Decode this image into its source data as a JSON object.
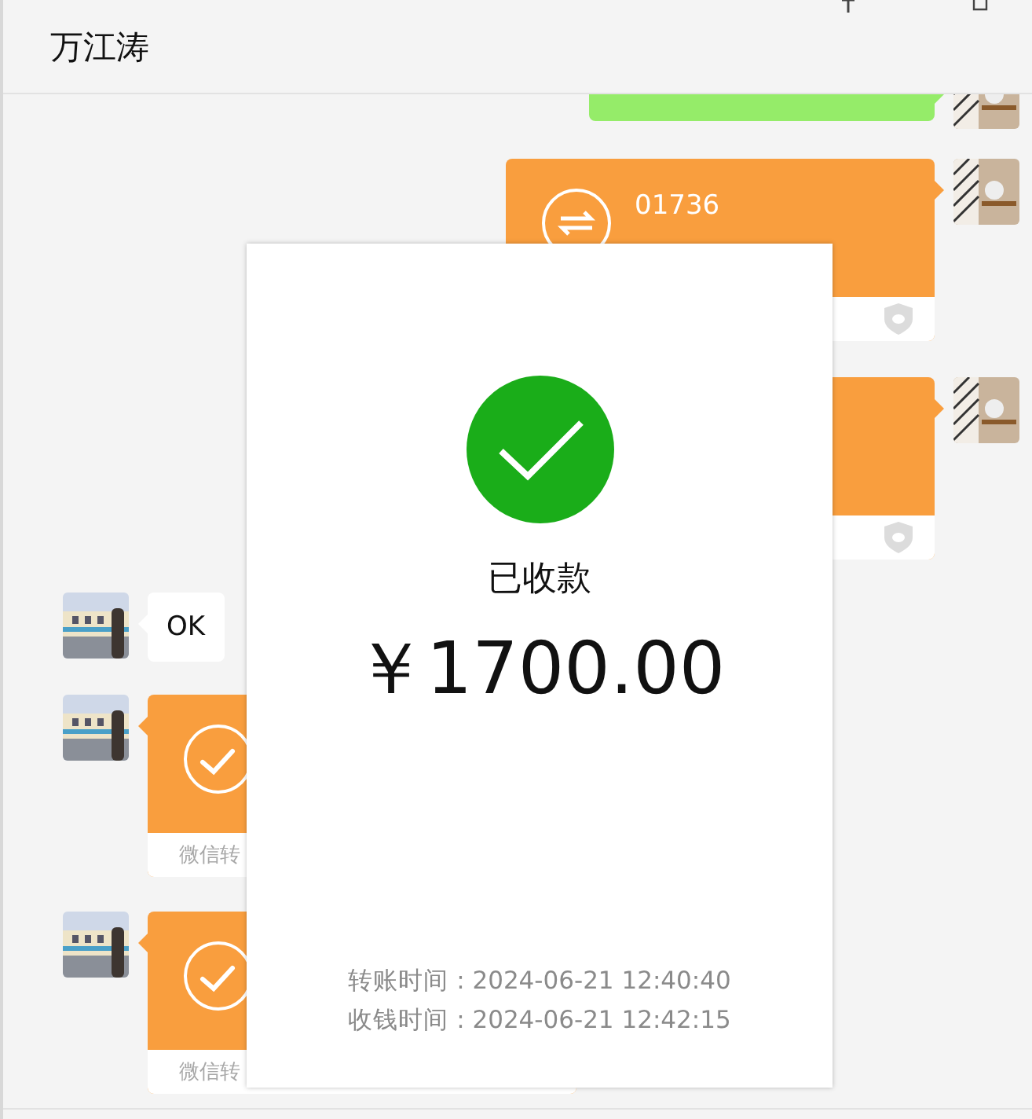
{
  "header": {
    "title": "万江涛"
  },
  "messages": [
    {
      "outgoing": true,
      "kind": "text"
    },
    {
      "outgoing": true,
      "kind": "transfer",
      "received": false,
      "title": "01736"
    },
    {
      "outgoing": true,
      "kind": "transfer",
      "received": false
    },
    {
      "outgoing": false,
      "kind": "text",
      "text": "OK"
    },
    {
      "outgoing": false,
      "kind": "transfer",
      "received": true,
      "footer": "微信转"
    },
    {
      "outgoing": false,
      "kind": "transfer",
      "received": true,
      "footer": "微信转"
    }
  ],
  "dialog": {
    "status": "已收款",
    "amount": "￥1700.00",
    "times": [
      "转账时间 : 2024-06-21 12:40:40",
      "收钱时间 : 2024-06-21 12:42:15"
    ]
  }
}
